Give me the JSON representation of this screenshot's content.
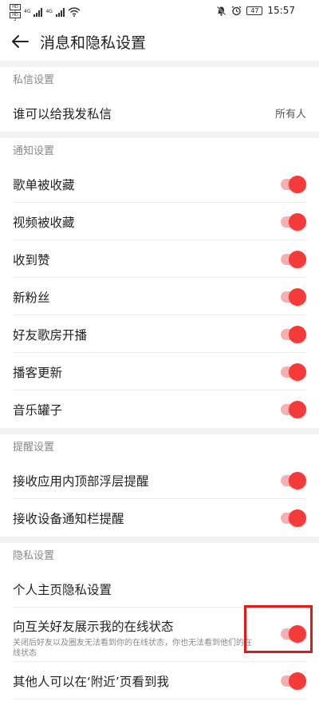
{
  "status_bar": {
    "sim1": "HD 1",
    "sim2": "HD 2",
    "net1": "4G",
    "net2": "4G",
    "battery": "47",
    "time": "15:57"
  },
  "header": {
    "title": "消息和隐私设置"
  },
  "sections": {
    "private_msg": {
      "title": "私信设置",
      "who_can_message": {
        "label": "谁可以给我发私信",
        "value": "所有人"
      }
    },
    "notify": {
      "title": "通知设置",
      "items": [
        {
          "label": "歌单被收藏",
          "on": true
        },
        {
          "label": "视频被收藏",
          "on": true
        },
        {
          "label": "收到赞",
          "on": true
        },
        {
          "label": "新粉丝",
          "on": true
        },
        {
          "label": "好友歌房开播",
          "on": true
        },
        {
          "label": "播客更新",
          "on": true
        },
        {
          "label": "音乐罐子",
          "on": true
        }
      ]
    },
    "remind": {
      "title": "提醒设置",
      "items": [
        {
          "label": "接收应用内顶部浮层提醒",
          "on": true
        },
        {
          "label": "接收设备通知栏提醒",
          "on": true
        }
      ]
    },
    "privacy": {
      "title": "隐私设置",
      "homepage": {
        "label": "个人主页隐私设置"
      },
      "online_status": {
        "label": "向互关好友展示我的在线状态",
        "desc": "关闭后好友以及圈友无法看到你的在线状态，你也无法看到他们的在线状态",
        "on": true
      },
      "nearby": {
        "label": "其他人可以在‘附近’页看到我",
        "on": true
      }
    }
  },
  "colors": {
    "accent": "#f53a3a",
    "track": "#f5b1b1",
    "highlight": "#e11919"
  }
}
